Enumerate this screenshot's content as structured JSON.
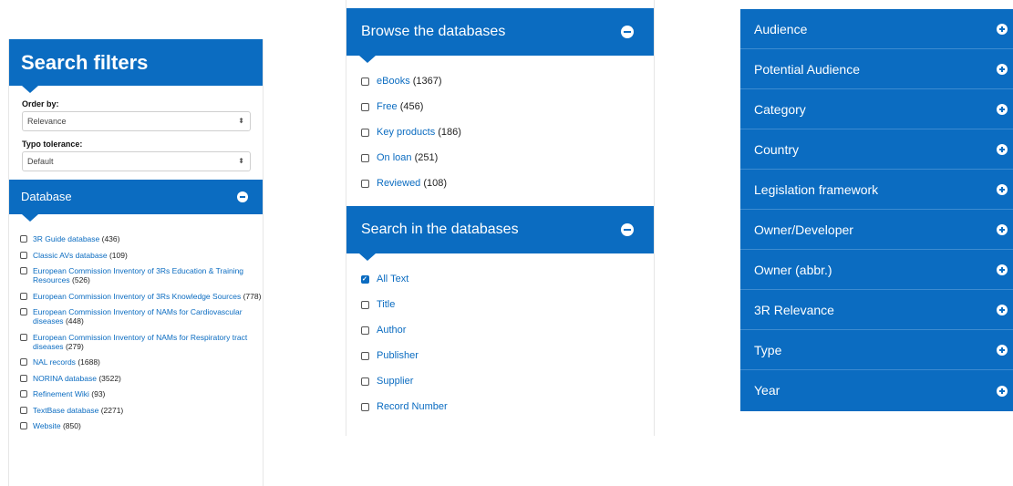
{
  "search_filters": {
    "title": "Search filters",
    "order_by": {
      "label": "Order by:",
      "value": "Relevance"
    },
    "typo_tolerance": {
      "label": "Typo tolerance:",
      "value": "Default"
    },
    "database": {
      "title": "Database",
      "items": [
        {
          "label": "3R Guide database",
          "count": "(436)"
        },
        {
          "label": "Classic AVs database",
          "count": "(109)"
        },
        {
          "label": "European Commission Inventory of 3Rs Education & Training Resources",
          "count": "(526)"
        },
        {
          "label": "European Commission Inventory of 3Rs Knowledge Sources",
          "count": "(778)"
        },
        {
          "label": "European Commission Inventory of NAMs for Cardiovascular diseases",
          "count": "(448)"
        },
        {
          "label": "European Commission Inventory of NAMs for Respiratory tract diseases",
          "count": "(279)"
        },
        {
          "label": "NAL records",
          "count": "(1688)"
        },
        {
          "label": "NORINA database",
          "count": "(3522)"
        },
        {
          "label": "Refinement Wiki",
          "count": "(93)"
        },
        {
          "label": "TextBase database",
          "count": "(2271)"
        },
        {
          "label": "Website",
          "count": "(850)"
        }
      ]
    }
  },
  "browse": {
    "title": "Browse the databases",
    "items": [
      {
        "label": "eBooks",
        "count": "(1367)"
      },
      {
        "label": "Free",
        "count": "(456)"
      },
      {
        "label": "Key products",
        "count": "(186)"
      },
      {
        "label": "On loan",
        "count": "(251)"
      },
      {
        "label": "Reviewed",
        "count": "(108)"
      }
    ]
  },
  "search_in": {
    "title": "Search in the databases",
    "items": [
      {
        "label": "All Text",
        "checked": true
      },
      {
        "label": "Title",
        "checked": false
      },
      {
        "label": "Author",
        "checked": false
      },
      {
        "label": "Publisher",
        "checked": false
      },
      {
        "label": "Supplier",
        "checked": false
      },
      {
        "label": "Record Number",
        "checked": false
      }
    ]
  },
  "facets": [
    "Audience",
    "Potential Audience",
    "Category",
    "Country",
    "Legislation framework",
    "Owner/Developer",
    "Owner (abbr.)",
    "3R Relevance",
    "Type",
    "Year"
  ],
  "colors": {
    "accent": "#0b6cc1",
    "link": "#0b6cc1"
  },
  "icons": {
    "collapse": "minus-circle-icon",
    "expand": "plus-circle-icon",
    "select": "up-down-chevron-icon"
  }
}
